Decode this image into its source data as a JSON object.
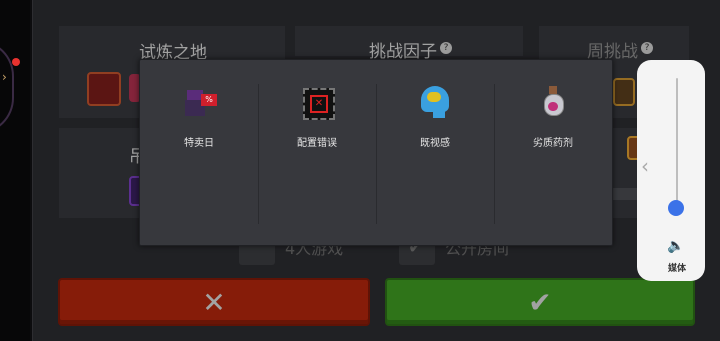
{
  "background": {
    "tiles": [
      {
        "title": "试炼之地"
      },
      {
        "title": "挑战因子"
      },
      {
        "title": "周挑战"
      },
      {
        "title": "吊"
      }
    ],
    "options": [
      {
        "label": "4人游戏"
      },
      {
        "label": "公开房间"
      }
    ],
    "cancel_symbol": "✕",
    "confirm_symbol": "✔"
  },
  "popup": {
    "factors": [
      {
        "label": "特卖日",
        "icon": "sale-merchant-icon"
      },
      {
        "label": "配置错误",
        "icon": "misconfigured-film-icon"
      },
      {
        "label": "既视感",
        "icon": "deja-vu-brain-icon"
      },
      {
        "label": "劣质药剂",
        "icon": "bad-potion-icon"
      }
    ]
  },
  "volume_panel": {
    "label": "媒体",
    "level": 0.0,
    "expand_symbol": "‹",
    "speaker_symbol": "🔈"
  },
  "colors": {
    "cancel": "#b3260c",
    "confirm": "#3f9b22",
    "volume_accent": "#3b72e8"
  }
}
